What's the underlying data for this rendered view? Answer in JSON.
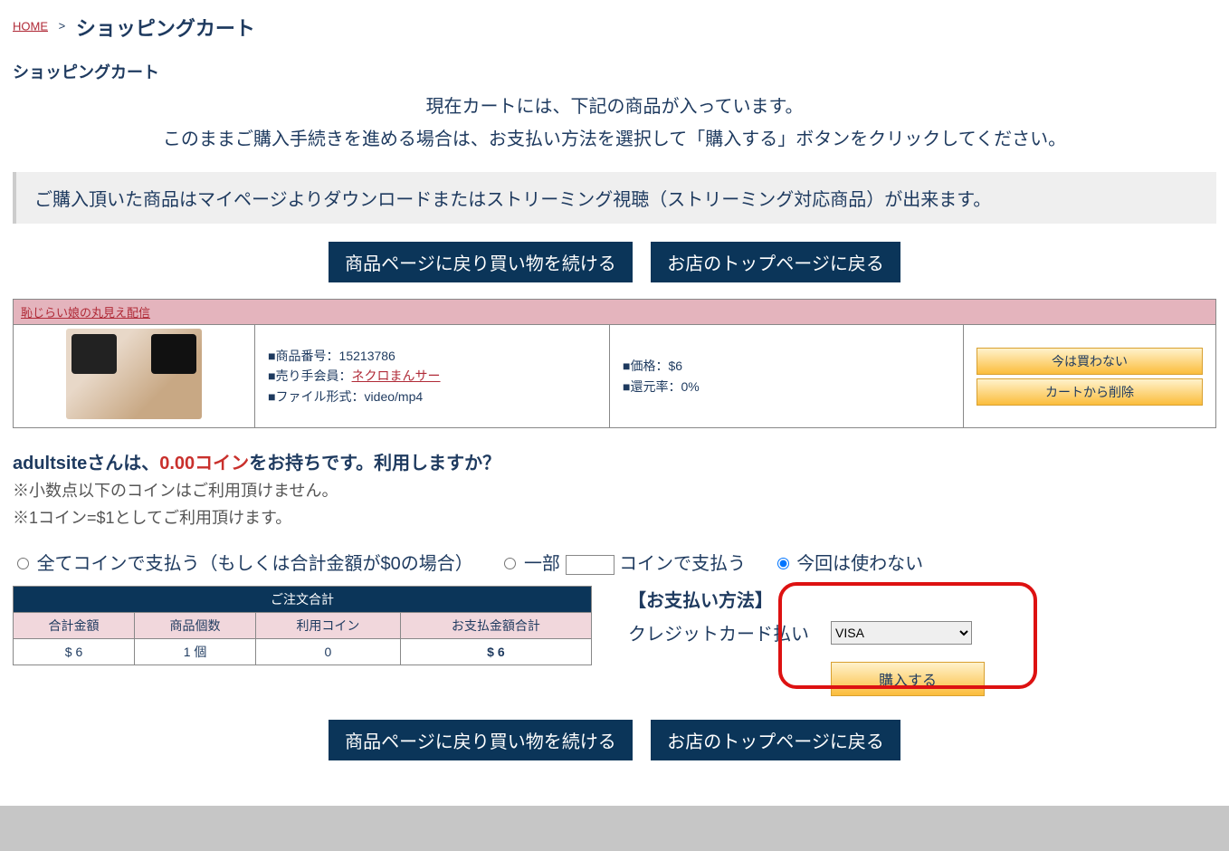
{
  "breadcrumb": {
    "home": "HOME",
    "sep": ">",
    "title": "ショッピングカート"
  },
  "subtitle": "ショッピングカート",
  "desc_line1": "現在カートには、下記の商品が入っています。",
  "desc_line2": "このままご購入手続きを進める場合は、お支払い方法を選択して「購入する」ボタンをクリックしてください。",
  "notice": "ご購入頂いた商品はマイページよりダウンロードまたはストリーミング視聴（ストリーミング対応商品）が出来ます。",
  "buttons": {
    "back_to_product": "商品ページに戻り買い物を続ける",
    "back_to_store": "お店のトップページに戻る"
  },
  "store_link": "恥じらい娘の丸見え配信",
  "item": {
    "num_label": "■商品番号：",
    "num": "15213786",
    "seller_label": "■売り手会員：",
    "seller": "ネクロまんサー",
    "format_label": "■ファイル形式：",
    "format": "video/mp4",
    "price_label": "■価格：",
    "price": "$6",
    "rebate_label": "■還元率：",
    "rebate": "0%"
  },
  "item_buttons": {
    "later": "今は買わない",
    "remove": "カートから削除"
  },
  "coin": {
    "user": "adultsite",
    "line_part1": "さんは、",
    "amount": "0.00コイン",
    "line_part2": "をお持ちです。利用しますか？",
    "note1": "※小数点以下のコインはご利用頂けません。",
    "note2": "※1コイン=$1としてご利用頂けます。",
    "opt_all": "全てコインで支払う（もしくは合計金額が$0の場合）",
    "opt_part_pre": "一部",
    "opt_part_post": "コインで支払う",
    "opt_none": "今回は使わない"
  },
  "summary": {
    "title": "ご注文合計",
    "cols": {
      "c1": "合計金額",
      "c2": "商品個数",
      "c3": "利用コイン",
      "c4": "お支払金額合計"
    },
    "vals": {
      "v1": "$ 6",
      "v2": "1 個",
      "v3": "0",
      "v4": "$ 6"
    }
  },
  "payment": {
    "title": "【お支払い方法】",
    "label": "クレジットカード払い",
    "select": "VISA",
    "buy": "購入する"
  }
}
